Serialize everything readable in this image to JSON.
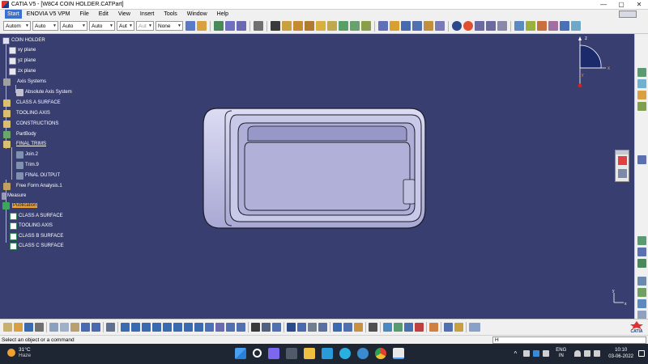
{
  "window": {
    "title": "CATIA V5 - [W8C4 COIN HOLDER.CATPart]",
    "minimize_icon": "—",
    "maximize_icon": "▢",
    "close_icon": "✕"
  },
  "menubar": {
    "items": [
      "Start",
      "ENOVIA V5 VPM",
      "File",
      "Edit",
      "View",
      "Insert",
      "Tools",
      "Window",
      "Help"
    ]
  },
  "toolbar": {
    "combos": [
      {
        "value": "Autom",
        "disabled": false
      },
      {
        "value": "Auto",
        "disabled": false
      },
      {
        "value": "Auto",
        "disabled": false
      },
      {
        "value": "Auto",
        "disabled": false
      },
      {
        "value": "Aut",
        "disabled": false
      },
      {
        "value": "Aut",
        "disabled": true
      },
      {
        "value": "None",
        "disabled": false
      }
    ],
    "combo_arrow": "▼"
  },
  "tree": {
    "root": "COIN HOLDER",
    "xy_plane": "xy plane",
    "yz_plane": "yz plane",
    "zx_plane": "zx plane",
    "axis_systems": "Axis Systems",
    "absolute_axis": "Absolute Axis System",
    "class_a_surface": "CLASS A SURFACE",
    "tooling_axis": "TOOLING AXIS",
    "constructions": "CONSTRUCTIONS",
    "partbody": "PartBody",
    "final_trims": "FINAL TRIMS",
    "join2": "Join.2",
    "trim9": "Trim.9",
    "final_output": "FINAL OUTPUT",
    "ffa": "Free Form Analysis.1",
    "measure": "Measure",
    "publication": "Publication",
    "pub_class_a": "CLASS A SURFACE",
    "pub_tooling": "TOOLING AXIS",
    "pub_class_b": "CLASS B SURFACE",
    "pub_class_c": "CLASS C SURFACE"
  },
  "compass": {
    "x_label": "x",
    "y_label": "y",
    "z_label": "z"
  },
  "triad": {
    "x_label": "x",
    "y_label": "y"
  },
  "catia_logo": "CATIA",
  "status": {
    "message": "Select an object or a command",
    "command_value": "H"
  },
  "taskbar": {
    "temperature": "31°C",
    "condition": "Haze",
    "language_line1": "ENG",
    "language_line2": "IN",
    "time": "10:10",
    "date": "03-06-2022",
    "chevron": "^"
  },
  "colors": {
    "viewport_bg": "#383e70",
    "part_fill": "#b8b8dc",
    "highlight": "#f0a030",
    "start_menu": "#3b6fd0"
  }
}
